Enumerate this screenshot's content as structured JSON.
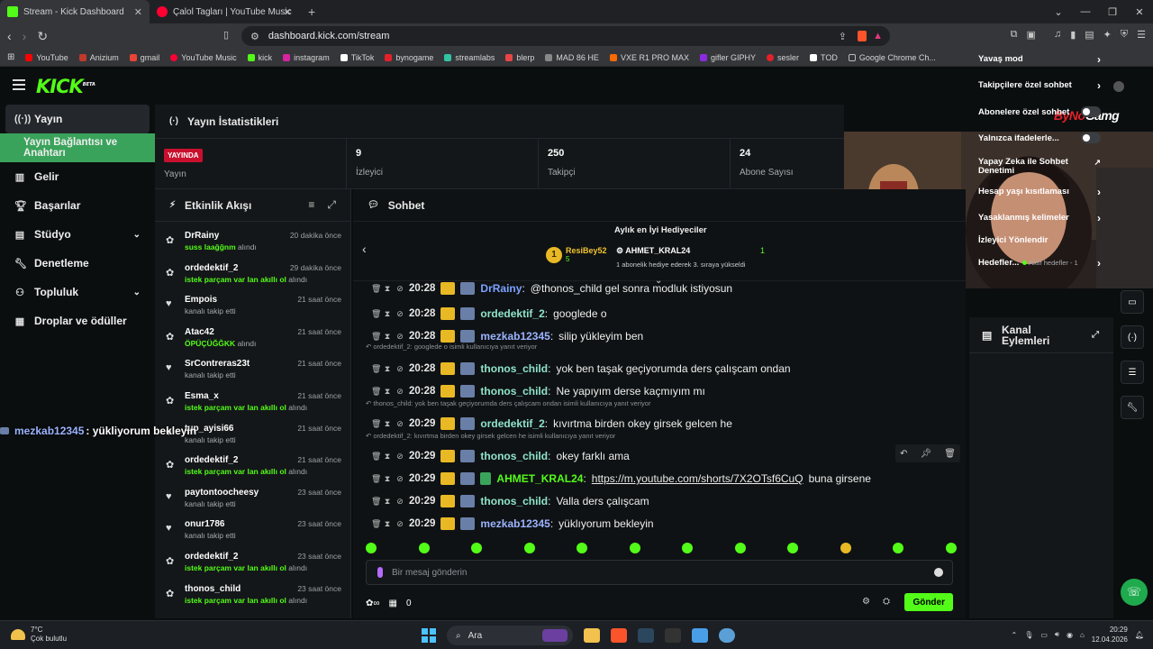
{
  "browser": {
    "tabs": [
      {
        "title": "Stream - Kick Dashboard",
        "color": "#53fc18"
      },
      {
        "title": "Çalol Tagları | YouTube Music",
        "color": "#ff0033"
      }
    ],
    "url": "dashboard.kick.com/stream",
    "bookmarks": [
      {
        "label": "YouTube",
        "color": "#ff0000"
      },
      {
        "label": "Anizium",
        "color": "#c0392b"
      },
      {
        "label": "gmail",
        "color": "#ea4335"
      },
      {
        "label": "YouTube Music",
        "color": "#ff0033"
      },
      {
        "label": "kick",
        "color": "#53fc18"
      },
      {
        "label": "instagram",
        "color": "#d6249f"
      },
      {
        "label": "TikTok",
        "color": "#ffffff"
      },
      {
        "label": "bynogame",
        "color": "#e4212a"
      },
      {
        "label": "streamlabs",
        "color": "#31c3a2"
      },
      {
        "label": "blerp",
        "color": "#e84545"
      },
      {
        "label": "MAD 86 HE",
        "color": "#888888"
      },
      {
        "label": "VXE R1 PRO MAX",
        "color": "#ff6a00"
      },
      {
        "label": "gifler GIPHY",
        "color": "#8a2be2"
      },
      {
        "label": "sesler",
        "color": "#e4212a"
      },
      {
        "label": "TOD",
        "color": "#ffffff"
      },
      {
        "label": "Google Chrome Ch...",
        "color": "#9e9e9e"
      }
    ]
  },
  "brand": {
    "logo": "KICK",
    "beta": "BETA"
  },
  "sidebar": {
    "items": [
      {
        "label": "Yayın",
        "icon": "broadcast-icon"
      },
      {
        "label": "Yayın Bağlantısı ve Anahtarı",
        "icon": ""
      },
      {
        "label": "Gelir",
        "icon": "chart-icon"
      },
      {
        "label": "Başarılar",
        "icon": "trophy-icon"
      },
      {
        "label": "Stüdyo",
        "icon": "studio-icon"
      },
      {
        "label": "Denetleme",
        "icon": "wrench-icon"
      },
      {
        "label": "Topluluk",
        "icon": "users-icon"
      },
      {
        "label": "Droplar ve ödüller",
        "icon": "gift-icon"
      }
    ]
  },
  "stats": {
    "title": "Yayın İstatistikleri",
    "live_badge": "YAYINDA",
    "items": [
      {
        "value": "",
        "label": "Yayın"
      },
      {
        "value": "9",
        "label": "İzleyici"
      },
      {
        "value": "250",
        "label": "Takipçi"
      },
      {
        "value": "24",
        "label": "Abone Sayısı"
      }
    ]
  },
  "activity": {
    "title": "Etkinlik Akışı",
    "events": [
      {
        "name": "DrRainy",
        "time": "20 dakika önce",
        "hl": "suss laağğnm",
        "desc": " alındı",
        "type": "reward"
      },
      {
        "name": "ordedektif_2",
        "time": "29 dakika önce",
        "hl": "istek parçam var lan akıllı ol",
        "desc": " alındı",
        "type": "reward"
      },
      {
        "name": "Empois",
        "time": "21 saat önce",
        "hl": "",
        "desc": "kanalı takip etti",
        "type": "follow"
      },
      {
        "name": "Atac42",
        "time": "21 saat önce",
        "hl": "ÖPÜÇÜĞĞKK",
        "desc": " alındı",
        "type": "reward"
      },
      {
        "name": "SrContreras23t",
        "time": "21 saat önce",
        "hl": "",
        "desc": "kanalı takip etti",
        "type": "follow"
      },
      {
        "name": "Esma_x",
        "time": "21 saat önce",
        "hl": "istek parçam var lan akıllı ol",
        "desc": " alındı",
        "type": "reward"
      },
      {
        "name": "tup_ayisi66",
        "time": "21 saat önce",
        "hl": "",
        "desc": "kanalı takip etti",
        "type": "follow"
      },
      {
        "name": "ordedektif_2",
        "time": "21 saat önce",
        "hl": "istek parçam var lan akıllı ol",
        "desc": " alındı",
        "type": "reward"
      },
      {
        "name": "paytontoocheesy",
        "time": "23 saat önce",
        "hl": "",
        "desc": "kanalı takip etti",
        "type": "follow"
      },
      {
        "name": "onur1786",
        "time": "23 saat önce",
        "hl": "",
        "desc": "kanalı takip etti",
        "type": "follow"
      },
      {
        "name": "ordedektif_2",
        "time": "23 saat önce",
        "hl": "istek parçam var lan akıllı ol",
        "desc": " alındı",
        "type": "reward"
      },
      {
        "name": "thonos_child",
        "time": "23 saat önce",
        "hl": "istek parçam var lan akıllı ol",
        "desc": " alındı",
        "type": "reward"
      }
    ]
  },
  "chat": {
    "title": "Sohbet",
    "gifters_title": "Aylık en İyi Hediyeciler",
    "gifter1": {
      "rank": "1",
      "name": "ResiBey52",
      "count": "5"
    },
    "gifter2": {
      "name": "AHMET_KRAL24",
      "count": "1",
      "sub": "1 abonelik hediye ederek 3. sıraya yükseldi"
    },
    "messages": [
      {
        "time": "20:28",
        "user": "DrRainy",
        "color": "#7aa2ff",
        "text": "@thonos_child gel sonra modluk istiyosun",
        "sub": false,
        "reply": ""
      },
      {
        "time": "20:28",
        "user": "ordedektif_2",
        "color": "#8fe3c9",
        "text": "googlede o",
        "sub": false,
        "reply": ""
      },
      {
        "time": "20:28",
        "user": "mezkab12345",
        "color": "#9ab3ff",
        "text": "silip yükleyim ben",
        "sub": false,
        "reply": ""
      },
      {
        "time": "20:28",
        "user": "thonos_child",
        "color": "#8fe3c9",
        "text": "yok ben taşak geçiyorumda ders çalışcam ondan",
        "sub": false,
        "reply": "ordedektif_2: googlede o isimli kullanıcıya yanıt veriyor"
      },
      {
        "time": "20:28",
        "user": "thonos_child",
        "color": "#8fe3c9",
        "text": "Ne yapıyım derse kaçmıyım mı",
        "sub": false,
        "reply": ""
      },
      {
        "time": "20:29",
        "user": "ordedektif_2",
        "color": "#8fe3c9",
        "text": "kıvırtma birden okey girsek gelcen he",
        "sub": false,
        "reply": "thonos_child: yok ben taşak geçiyorumda ders çalışcam ondan isimli kullanıcıya yanıt veriyor"
      },
      {
        "time": "20:29",
        "user": "thonos_child",
        "color": "#8fe3c9",
        "text": "okey farklı ama",
        "sub": false,
        "reply": "ordedektif_2: kıvırtma birden okey girsek gelcen he isimli kullanıcıya yanıt veriyor"
      },
      {
        "time": "20:29",
        "user": "AHMET_KRAL24",
        "color": "#53fc18",
        "text": "buna girsene",
        "link": "https://m.youtube.com/shorts/7X2OTsf6CuQ",
        "sub": true,
        "reply": ""
      },
      {
        "time": "20:29",
        "user": "thonos_child",
        "color": "#8fe3c9",
        "text": "Valla ders çalışcam",
        "sub": false,
        "reply": ""
      },
      {
        "time": "20:29",
        "user": "mezkab12345",
        "color": "#9ab3ff",
        "text": "yüklıyorum bekleyin",
        "sub": false,
        "reply": ""
      }
    ],
    "placeholder": "Bir mesaj gönderin",
    "points": "0",
    "send_label": "Gönder"
  },
  "overlay_msg": {
    "user": "mezkab12345",
    "text": ": yükliyorum bekleyin"
  },
  "sponsor": {
    "part1": "ByNo",
    "part2": "Gamg"
  },
  "channel_actions": {
    "title1": "Kanal",
    "title2": "Eylemleri",
    "items": [
      {
        "label": "Yavaş mod",
        "control": "arrow"
      },
      {
        "label": "Takipçilere özel sohbet",
        "control": "arrow"
      },
      {
        "label": "Abonelere özel sohbet",
        "control": "toggle"
      },
      {
        "label": "Yalnızca ifadelerle...",
        "control": "toggle"
      },
      {
        "label": "Yapay Zeka ile Sohbet Denetimi",
        "control": "external"
      },
      {
        "label": "Hesap yaşı kısıtlaması",
        "control": "arrow"
      },
      {
        "label": "Yasaklanmış kelimeler",
        "control": "arrow"
      },
      {
        "label": "İzleyici Yönlendir",
        "control": "none"
      },
      {
        "label": "Hedefler...",
        "control": "arrow",
        "extra": "Aktif hedefler - 1"
      }
    ]
  },
  "taskbar": {
    "temp": "7°C",
    "weather": "Çok bulutlu",
    "search": "Ara",
    "time": "20:29",
    "date": "12.04.2026"
  }
}
